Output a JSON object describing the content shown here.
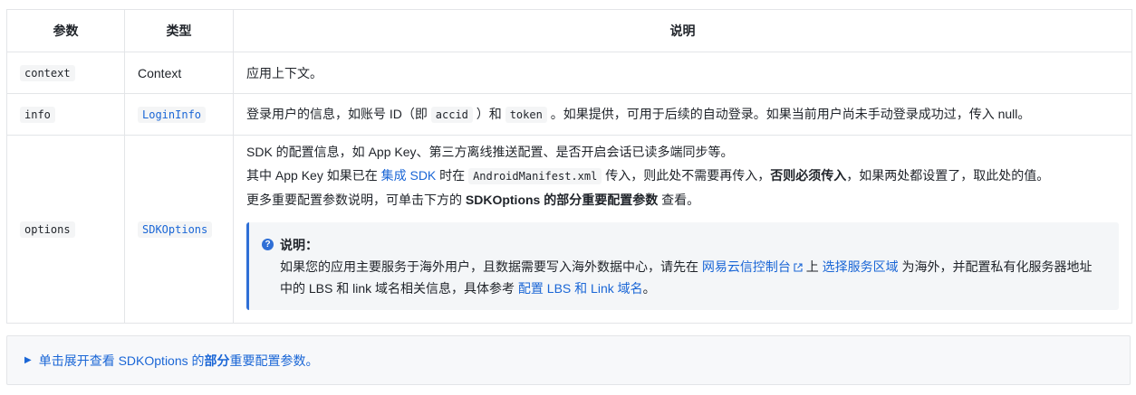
{
  "table": {
    "headers": [
      "参数",
      "类型",
      "说明"
    ],
    "rows": [
      {
        "param": "context",
        "type": "Context",
        "desc": "应用上下文。"
      },
      {
        "param": "info",
        "type": "LoginInfo",
        "desc": {
          "p1": "登录用户的信息，如账号 ID（即 ",
          "code1": "accid",
          "p2": " ）和 ",
          "code2": "token",
          "p3": " 。如果提供，可用于后续的自动登录。如果当前用户尚未手动登录成功过，传入 null。"
        }
      },
      {
        "param": "options",
        "type": "SDKOptions",
        "desc": {
          "line1": "SDK 的配置信息，如 App Key、第三方离线推送配置、是否开启会话已读多端同步等。",
          "line2_a": "其中 App Key 如果已在 ",
          "line2_link": "集成 SDK",
          "line2_b": " 时在 ",
          "line2_code": "AndroidManifest.xml",
          "line2_c": " 传入，则此处不需要再传入，",
          "line2_bold": "否则必须传入",
          "line2_d": "，如果两处都设置了，取此处的值。",
          "line3_a": "更多重要配置参数说明，可单击下方的 ",
          "line3_bold": "SDKOptions 的部分重要配置参数",
          "line3_b": " 查看。"
        },
        "note": {
          "title": "说明：",
          "a": "如果您的应用主要服务于海外用户，且数据需要写入海外数据中心，请先在 ",
          "link1": "网易云信控制台",
          "b": " 上 ",
          "link2": "选择服务区域",
          "c": " 为海外，并配置私有化服务器地址",
          "d": "中的 LBS 和 link 域名相关信息，具体参考 ",
          "link3": "配置 LBS 和 Link 域名",
          "e": "。"
        }
      }
    ]
  },
  "expand": {
    "a": "单击展开查看 SDKOptions 的 ",
    "bold": "部分",
    "b": " 重要配置参数。"
  },
  "colors": {
    "link": "#1a66d6",
    "note_border": "#2f6fd6",
    "border": "#e3e5e8"
  },
  "icons": [
    "question-circle-icon",
    "external-link-icon",
    "triangle-right-icon"
  ]
}
